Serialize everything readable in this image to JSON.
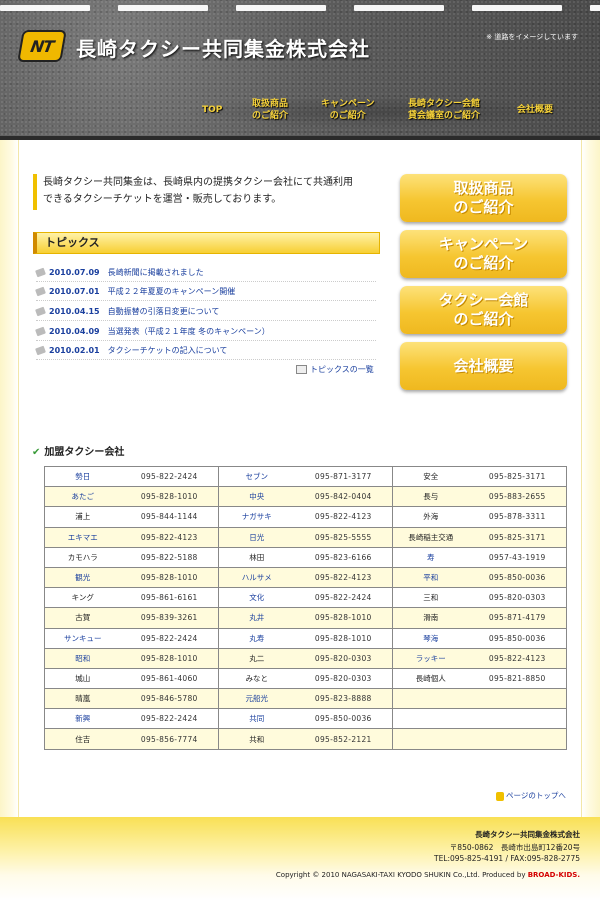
{
  "header": {
    "logo_text": "NT",
    "site_title": "長崎タクシー共同集金株式会社",
    "note": "※ 道路をイメージしています",
    "nav": [
      {
        "line1": "TOP",
        "line2": ""
      },
      {
        "line1": "取扱商品",
        "line2": "のご紹介"
      },
      {
        "line1": "キャンペーン",
        "line2": "のご紹介"
      },
      {
        "line1": "長崎タクシー会館",
        "line2": "貸会議室のご紹介"
      },
      {
        "line1": "会社概要",
        "line2": ""
      }
    ]
  },
  "lead": {
    "line1": "長崎タクシー共同集金は、長崎県内の提携タクシー会社にて共通利用",
    "line2": "できるタクシーチケットを運営・販売しております。"
  },
  "topics": {
    "heading": "トピックス",
    "items": [
      {
        "date": "2010.07.09",
        "title": "長崎新聞に掲載されました"
      },
      {
        "date": "2010.07.01",
        "title": "平成２２年夏夏のキャンペーン開催"
      },
      {
        "date": "2010.04.15",
        "title": "自動振替の引落日変更について"
      },
      {
        "date": "2010.04.09",
        "title": "当選発表（平成２１年度 冬のキャンペーン）"
      },
      {
        "date": "2010.02.01",
        "title": "タクシーチケットの記入について"
      }
    ],
    "more": "トピックスの一覧"
  },
  "side_buttons": [
    {
      "line1": "取扱商品",
      "line2": "のご紹介"
    },
    {
      "line1": "キャンペーン",
      "line2": "のご紹介"
    },
    {
      "line1": "タクシー会館",
      "line2": "のご紹介"
    },
    {
      "line1": "会社概要",
      "line2": ""
    }
  ],
  "members": {
    "heading": "加盟タクシー会社",
    "rows": [
      [
        {
          "name": "勢日",
          "tel": "095-822-2424",
          "link": true
        },
        {
          "name": "セブン",
          "tel": "095-871-3177",
          "link": true
        },
        {
          "name": "安全",
          "tel": "095-825-3171",
          "link": false
        }
      ],
      [
        {
          "name": "あたご",
          "tel": "095-828-1010",
          "link": true
        },
        {
          "name": "中央",
          "tel": "095-842-0404",
          "link": true
        },
        {
          "name": "長与",
          "tel": "095-883-2655",
          "link": false
        }
      ],
      [
        {
          "name": "浦上",
          "tel": "095-844-1144",
          "link": false
        },
        {
          "name": "ナガサキ",
          "tel": "095-822-4123",
          "link": true
        },
        {
          "name": "外海",
          "tel": "095-878-3311",
          "link": false
        }
      ],
      [
        {
          "name": "エキマエ",
          "tel": "095-822-4123",
          "link": true
        },
        {
          "name": "日光",
          "tel": "095-825-5555",
          "link": true
        },
        {
          "name": "長崎稲主交通",
          "tel": "095-825-3171",
          "link": false
        }
      ],
      [
        {
          "name": "カモハラ",
          "tel": "095-822-5188",
          "link": false
        },
        {
          "name": "林田",
          "tel": "095-823-6166",
          "link": false
        },
        {
          "name": "寿",
          "tel": "0957-43-1919",
          "link": true
        }
      ],
      [
        {
          "name": "観光",
          "tel": "095-828-1010",
          "link": true
        },
        {
          "name": "ハルサメ",
          "tel": "095-822-4123",
          "link": true
        },
        {
          "name": "平和",
          "tel": "095-850-0036",
          "link": true
        }
      ],
      [
        {
          "name": "キング",
          "tel": "095-861-6161",
          "link": false
        },
        {
          "name": "文化",
          "tel": "095-822-2424",
          "link": true
        },
        {
          "name": "三和",
          "tel": "095-820-0303",
          "link": false
        }
      ],
      [
        {
          "name": "古賀",
          "tel": "095-839-3261",
          "link": false
        },
        {
          "name": "丸井",
          "tel": "095-828-1010",
          "link": true
        },
        {
          "name": "滑南",
          "tel": "095-871-4179",
          "link": false
        }
      ],
      [
        {
          "name": "サンキュー",
          "tel": "095-822-2424",
          "link": true
        },
        {
          "name": "丸寿",
          "tel": "095-828-1010",
          "link": true
        },
        {
          "name": "琴海",
          "tel": "095-850-0036",
          "link": true
        }
      ],
      [
        {
          "name": "昭和",
          "tel": "095-828-1010",
          "link": true
        },
        {
          "name": "丸二",
          "tel": "095-820-0303",
          "link": false
        },
        {
          "name": "ラッキー",
          "tel": "095-822-4123",
          "link": true
        }
      ],
      [
        {
          "name": "城山",
          "tel": "095-861-4060",
          "link": false
        },
        {
          "name": "みなと",
          "tel": "095-820-0303",
          "link": false
        },
        {
          "name": "長崎個人",
          "tel": "095-821-8850",
          "link": false
        }
      ],
      [
        {
          "name": "晴嵐",
          "tel": "095-846-5780",
          "link": false
        },
        {
          "name": "元船光",
          "tel": "095-823-8888",
          "link": true
        },
        {
          "name": "",
          "tel": "",
          "link": false
        }
      ],
      [
        {
          "name": "新興",
          "tel": "095-822-2424",
          "link": true
        },
        {
          "name": "共同",
          "tel": "095-850-0036",
          "link": true
        },
        {
          "name": "",
          "tel": "",
          "link": false
        }
      ],
      [
        {
          "name": "住吉",
          "tel": "095-856-7774",
          "link": false
        },
        {
          "name": "共和",
          "tel": "095-852-2121",
          "link": false
        },
        {
          "name": "",
          "tel": "",
          "link": false
        }
      ]
    ]
  },
  "pagetop": "ページのトップへ",
  "footer": {
    "company": "長崎タクシー共同集金株式会社",
    "address": "〒850-0862　長崎市出島町12番20号",
    "tel": "TEL:095-825-4191 / FAX:095-828-2775",
    "copyright": "Copyright © 2010 NAGASAKI-TAXI KYODO SHUKIN Co.,Ltd. Produced by ",
    "producer": "BROAD-KIDS."
  }
}
